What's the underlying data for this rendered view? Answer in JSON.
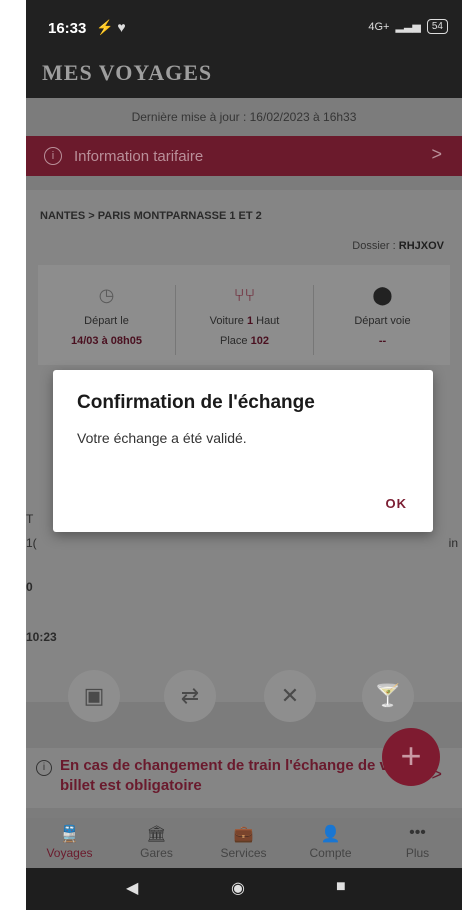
{
  "status_bar": {
    "time": "16:33",
    "left_icons": "⚡ ♥",
    "network": "4G+",
    "battery": "54"
  },
  "header": {
    "title": "MES VOYAGES"
  },
  "update": {
    "text": "Dernière mise à jour : 16/02/2023 à 16h33"
  },
  "info_bar": {
    "icon": "i",
    "label": "Information tarifaire",
    "chevron": ">"
  },
  "trip": {
    "route": "NANTES > PARIS MONTPARNASSE 1 ET 2",
    "dossier_label": "Dossier : ",
    "dossier_code": "RHJXOV",
    "departure": {
      "label": "Départ le",
      "value": "14/03 à 08h05"
    },
    "coach": {
      "label_prefix": "Voiture ",
      "coach_number": "1",
      "label_suffix": " Haut",
      "seat_label": "Place ",
      "seat_number": "102"
    },
    "platform": {
      "label": "Départ voie",
      "value": "--"
    },
    "peek_left_1": "T",
    "peek_left_2": "1(",
    "peek_right": "in",
    "peek_left_3": "0",
    "peek_bottom": "10:23"
  },
  "dialog": {
    "title": "Confirmation de l'échange",
    "message": "Votre échange a été validé.",
    "ok_label": "OK"
  },
  "actions": [
    {
      "icon": "qr-code-icon",
      "symbol": "▣"
    },
    {
      "icon": "exchange-icon",
      "symbol": "⇄"
    },
    {
      "icon": "cancel-icon",
      "symbol": "✕"
    },
    {
      "icon": "bar-icon",
      "symbol": "🍸"
    }
  ],
  "change_notice": {
    "icon": "i",
    "text": "En cas de changement de train l'échange de votre billet est obligatoire",
    "chevron": ">"
  },
  "fab": {
    "symbol": "+"
  },
  "nav": [
    {
      "label": "Voyages",
      "icon": "train-icon",
      "symbol": "🚆"
    },
    {
      "label": "Gares",
      "icon": "station-icon",
      "symbol": "🏛"
    },
    {
      "label": "Services",
      "icon": "briefcase-icon",
      "symbol": "💼"
    },
    {
      "label": "Compte",
      "icon": "account-icon",
      "symbol": "👤"
    },
    {
      "label": "Plus",
      "icon": "more-icon",
      "symbol": "•••"
    }
  ],
  "colors": {
    "brand": "#7c1e33",
    "overlay": "#7c7c7c"
  }
}
